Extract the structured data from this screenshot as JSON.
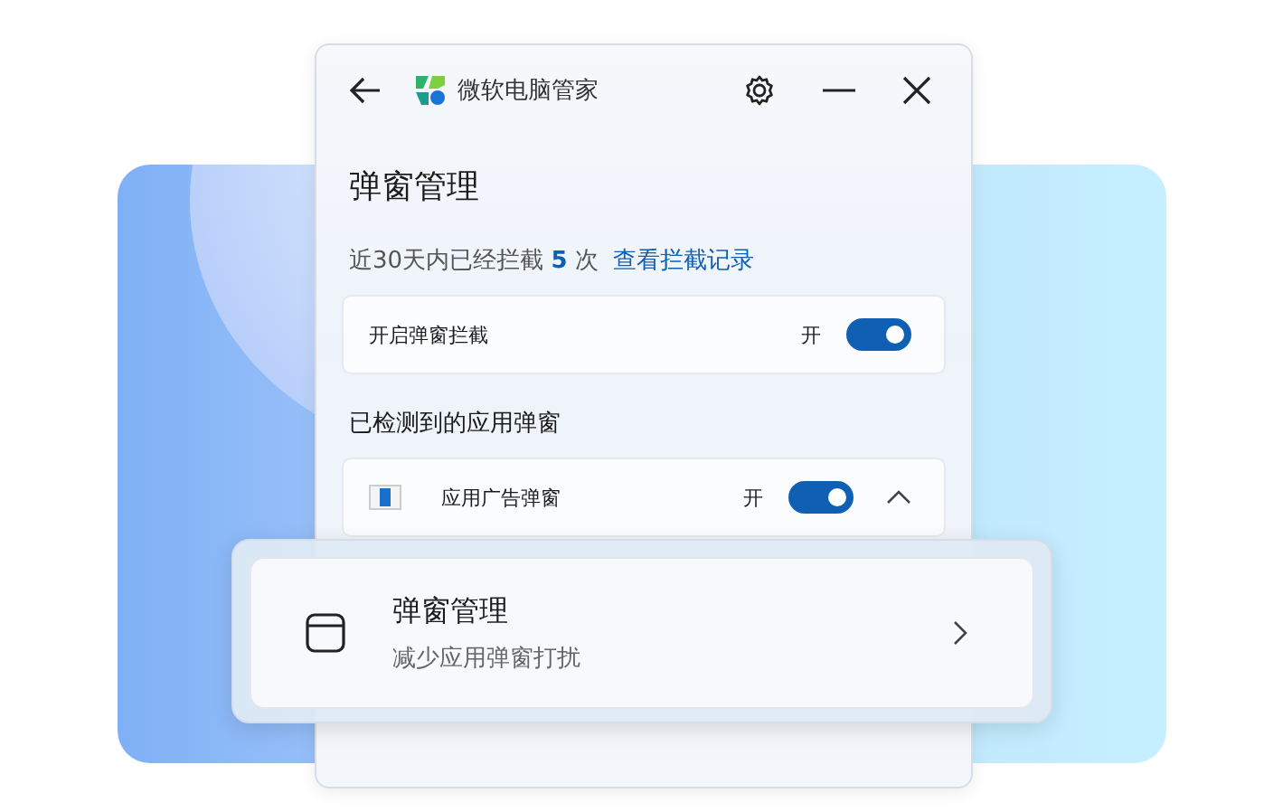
{
  "app": {
    "title": "微软电脑管家"
  },
  "page": {
    "title": "弹窗管理",
    "stats": "近30天内已经拦截 **5** 次",
    "stats_link": "查看拦截记录"
  },
  "main_toggle": {
    "label": "开启弹窗拦截",
    "state_text": "开",
    "on": true
  },
  "section": {
    "title": "已检测到的应用弹窗"
  },
  "detected": [
    {
      "label": "应用广告弹窗",
      "state_text": "开",
      "on": true,
      "expanded": true
    }
  ],
  "feature_card": {
    "title": "弹窗管理",
    "subtitle": "减少应用弹窗打扰"
  }
}
